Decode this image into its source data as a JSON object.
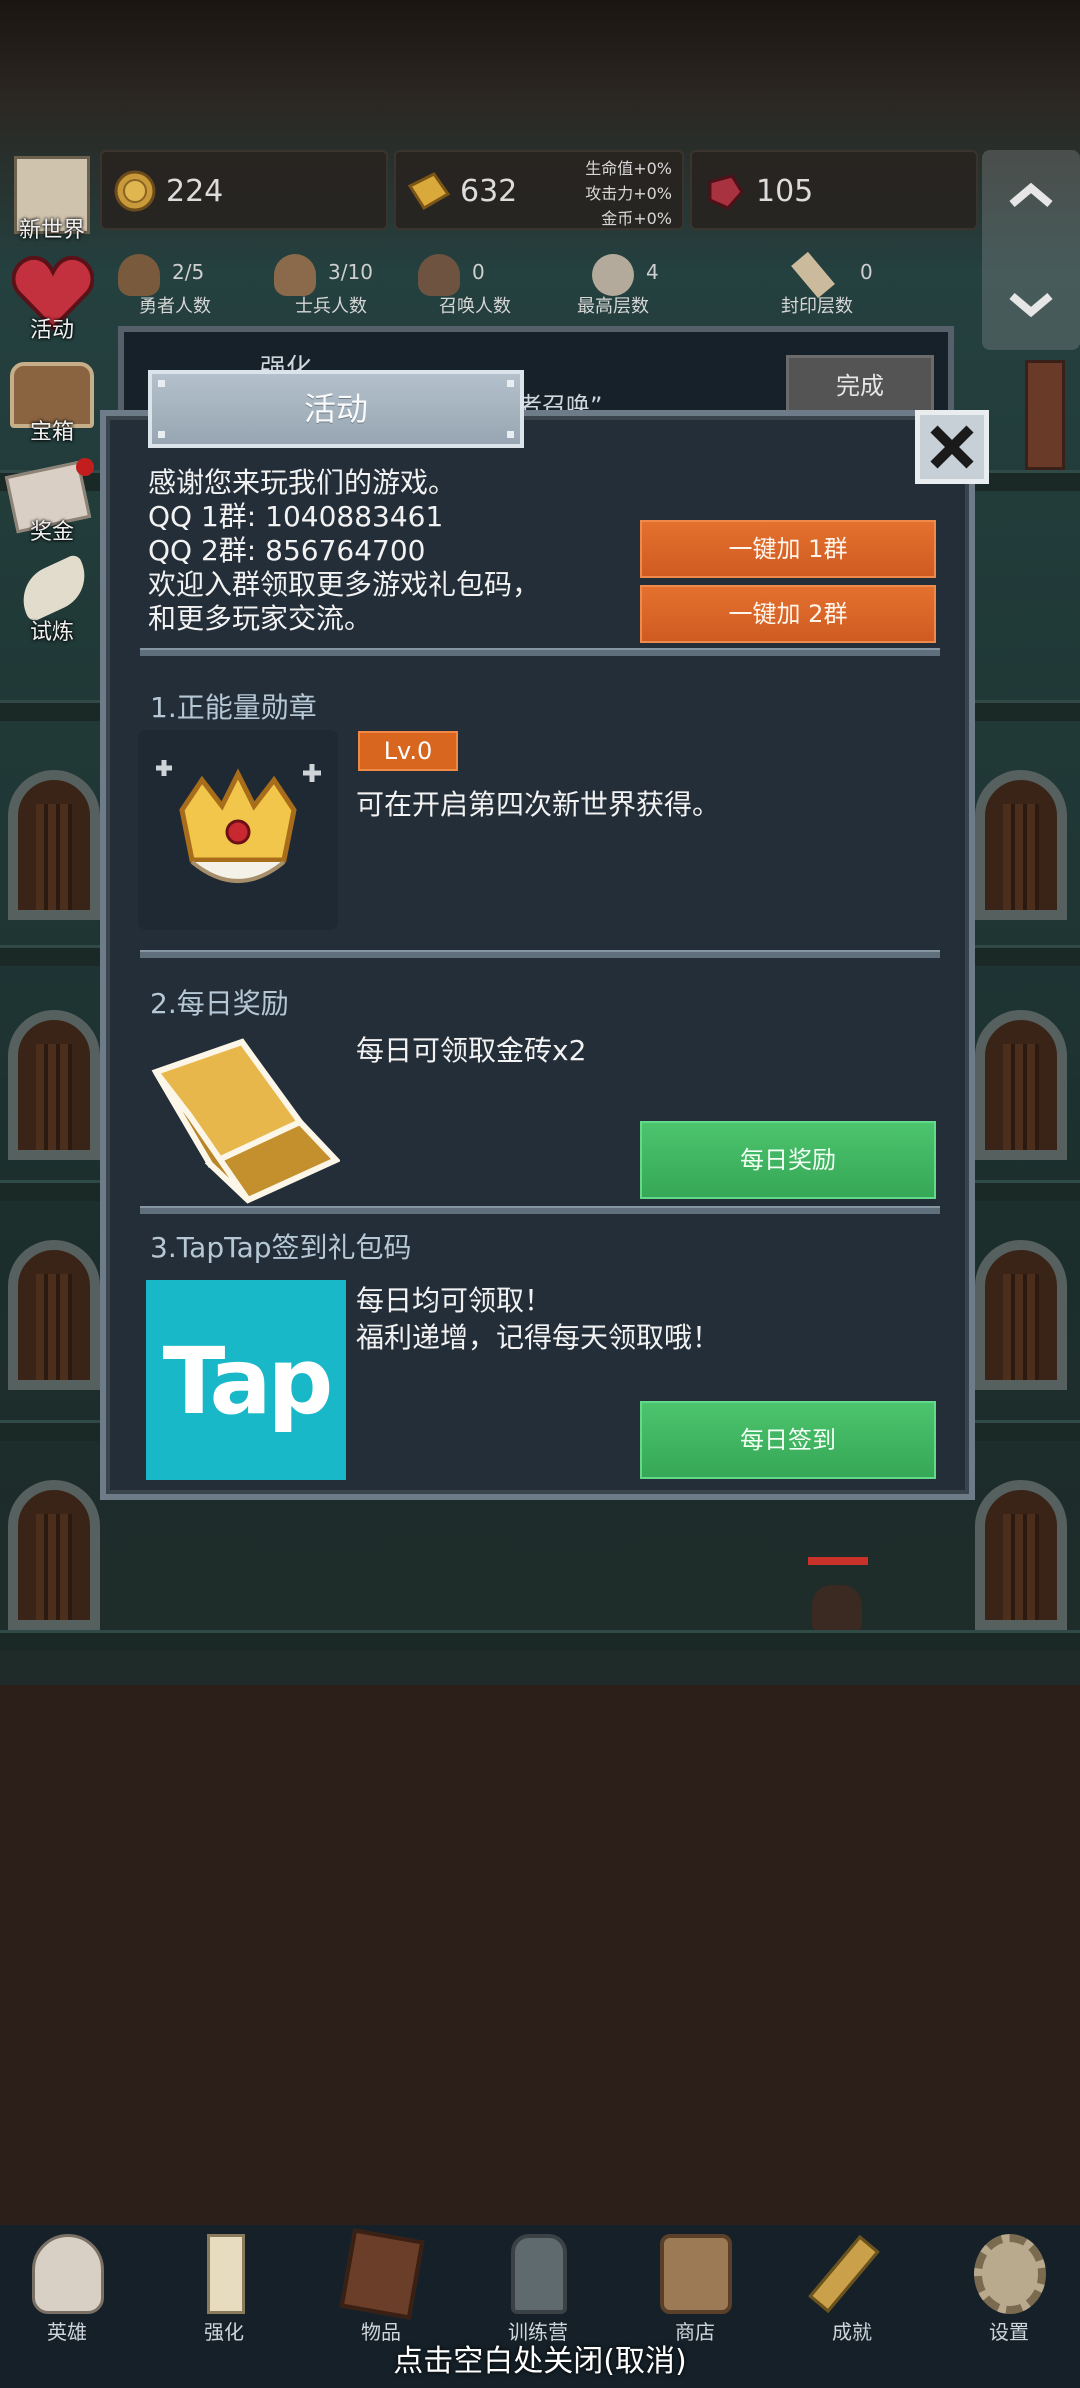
{
  "resources": {
    "coin": {
      "icon": "coin-icon",
      "value": "224"
    },
    "gold_bar": {
      "icon": "gold-bar-icon",
      "value": "632"
    },
    "buffs": [
      "生命值+0%",
      "攻击力+0%",
      "金币+0%"
    ],
    "gem": {
      "icon": "red-gem-icon",
      "value": "105"
    }
  },
  "stats": [
    {
      "icon": "hero-head-icon",
      "value": "2/5",
      "label": "勇者人数"
    },
    {
      "icon": "soldier-head-icon",
      "value": "3/10",
      "label": "士兵人数"
    },
    {
      "icon": "summon-head-icon",
      "value": "0",
      "label": "召唤人数"
    },
    {
      "icon": "rock-icon",
      "value": "4",
      "label": "最高层数"
    },
    {
      "icon": "scroll-icon",
      "value": "0",
      "label": "封印层数"
    }
  ],
  "side_menu": [
    {
      "icon": "map-icon",
      "label": "新世界"
    },
    {
      "icon": "heart-icon",
      "label": "活动"
    },
    {
      "icon": "chest-icon",
      "label": "宝箱"
    },
    {
      "icon": "envelope-icon",
      "label": "奖金"
    },
    {
      "icon": "feather-icon",
      "label": "试炼"
    }
  ],
  "task": {
    "title": "强化",
    "subtitle": "者召唤”",
    "done_label": "完成"
  },
  "modal": {
    "title": "活动",
    "intro": {
      "lines": [
        "感谢您来玩我们的游戏。",
        "QQ 1群: 1040883461",
        "QQ 2群: 856764700",
        "欢迎入群领取更多游戏礼包码，",
        "和更多玩家交流。"
      ],
      "join1_label": "一键加 1群",
      "join2_label": "一键加 2群"
    },
    "section1": {
      "title": "1.正能量勋章",
      "badge": "Lv.0",
      "desc": "可在开启第四次新世界获得。",
      "icon": "crown-medal-icon"
    },
    "section2": {
      "title": "2.每日奖励",
      "desc": "每日可领取金砖x2",
      "button": "每日奖励",
      "icon": "gold-brick-icon"
    },
    "section3": {
      "title": "3.TapTap签到礼包码",
      "desc_lines": [
        "每日均可领取！",
        "福利递增，记得每天领取哦！"
      ],
      "button": "每日签到",
      "logo_text": "Tap"
    }
  },
  "bottom_nav": [
    {
      "icon": "skull-icon",
      "label": "英雄"
    },
    {
      "icon": "candle-icon",
      "label": "强化"
    },
    {
      "icon": "book-icon",
      "label": "物品"
    },
    {
      "icon": "lantern-icon",
      "label": "训练营"
    },
    {
      "icon": "beer-mug-icon",
      "label": "商店"
    },
    {
      "icon": "key-icon",
      "label": "成就"
    },
    {
      "icon": "gear-icon",
      "label": "设置"
    }
  ],
  "close_hint": "点击空白处关闭(取消)"
}
